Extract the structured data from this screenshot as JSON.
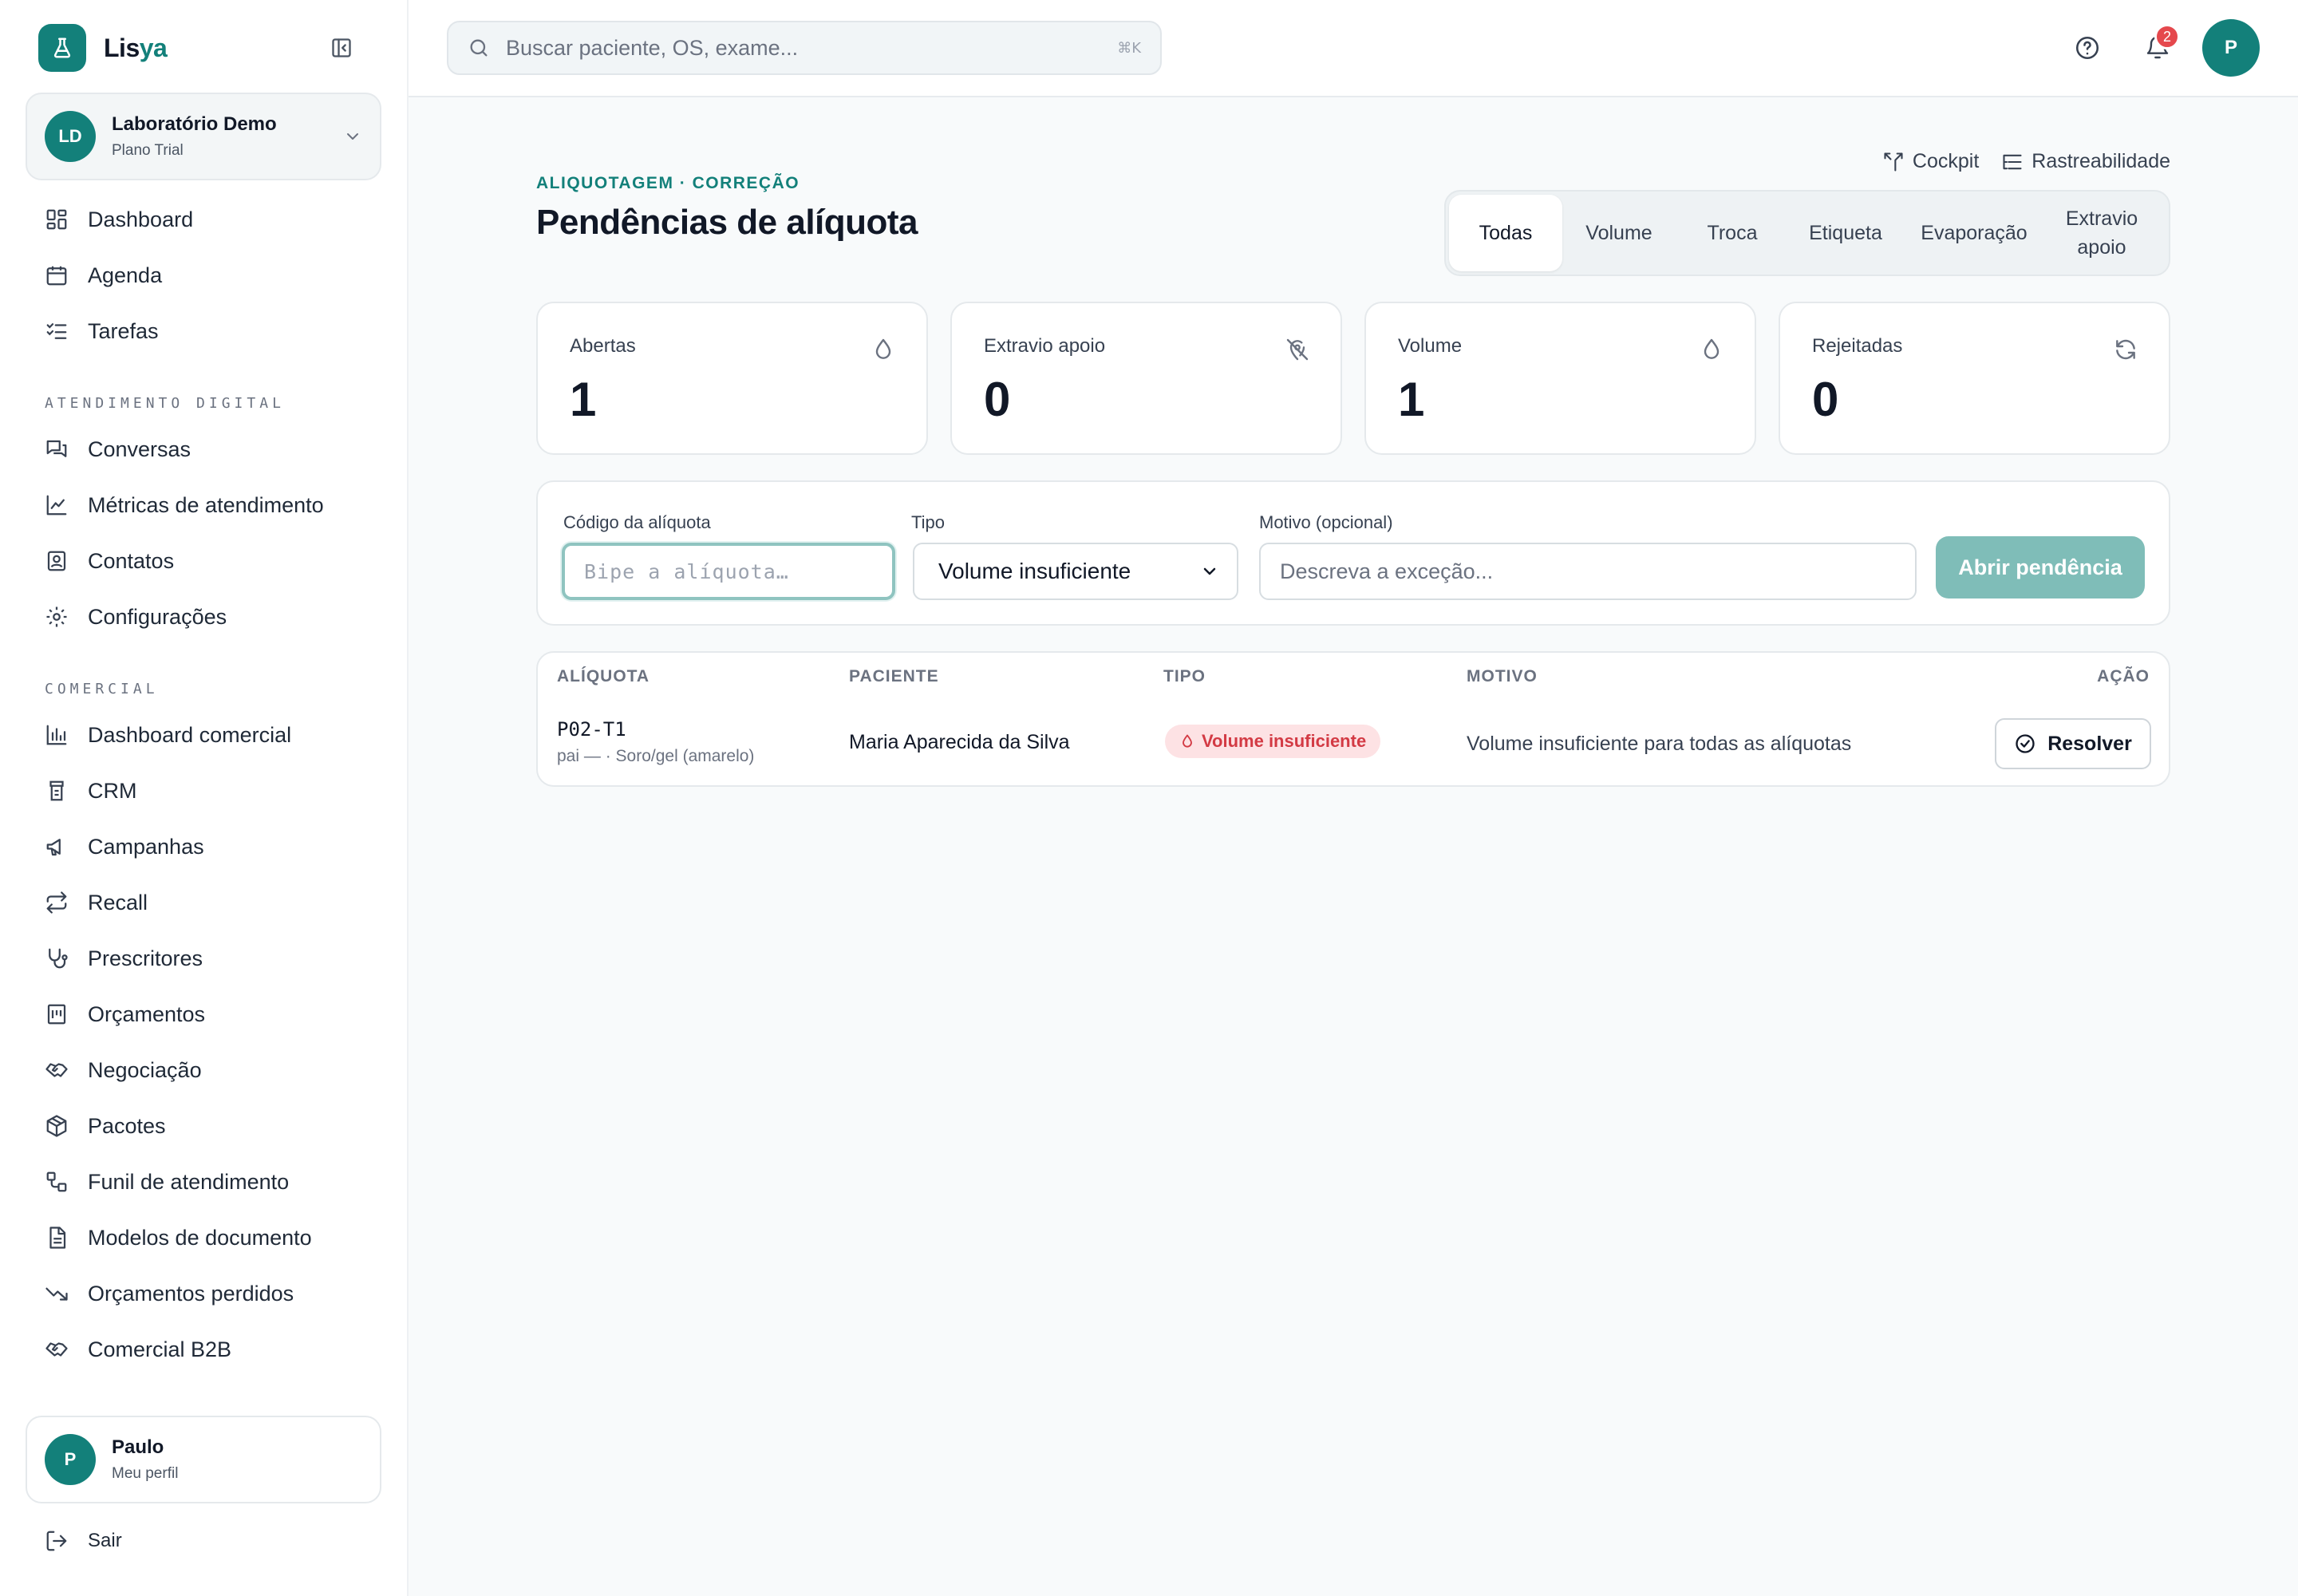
{
  "brand": {
    "name_prefix": "Lis",
    "name_suffix": "ya"
  },
  "org": {
    "initials": "LD",
    "name": "Laboratório Demo",
    "plan": "Plano Trial"
  },
  "nav": {
    "main": [
      {
        "label": "Dashboard",
        "icon": "dashboard-icon"
      },
      {
        "label": "Agenda",
        "icon": "calendar-icon"
      },
      {
        "label": "Tarefas",
        "icon": "tasks-icon"
      }
    ],
    "section_digital": "ATENDIMENTO DIGITAL",
    "digital": [
      {
        "label": "Conversas",
        "icon": "chat-icon"
      },
      {
        "label": "Métricas de atendimento",
        "icon": "line-chart-icon"
      },
      {
        "label": "Contatos",
        "icon": "contacts-icon"
      },
      {
        "label": "Configurações",
        "icon": "gear-icon"
      }
    ],
    "section_comercial": "COMERCIAL",
    "comercial": [
      {
        "label": "Dashboard comercial",
        "icon": "bar-chart-icon"
      },
      {
        "label": "CRM",
        "icon": "crm-icon"
      },
      {
        "label": "Campanhas",
        "icon": "megaphone-icon"
      },
      {
        "label": "Recall",
        "icon": "repeat-icon"
      },
      {
        "label": "Prescritores",
        "icon": "stethoscope-icon"
      },
      {
        "label": "Orçamentos",
        "icon": "receipt-icon"
      },
      {
        "label": "Negociação",
        "icon": "handshake-icon"
      },
      {
        "label": "Pacotes",
        "icon": "package-icon"
      },
      {
        "label": "Funil de atendimento",
        "icon": "workflow-icon"
      },
      {
        "label": "Modelos de documento",
        "icon": "document-icon"
      },
      {
        "label": "Orçamentos perdidos",
        "icon": "trending-down-icon"
      },
      {
        "label": "Comercial B2B",
        "icon": "handshake-icon"
      }
    ]
  },
  "profile": {
    "initial": "P",
    "name": "Paulo",
    "subtitle": "Meu perfil"
  },
  "logout_label": "Sair",
  "search": {
    "placeholder": "Buscar paciente, OS, exame...",
    "shortcut": "⌘K"
  },
  "notifications": {
    "count": "2"
  },
  "user_avatar": "P",
  "page": {
    "eyebrow": "ALIQUOTAGEM · CORREÇÃO",
    "title": "Pendências de alíquota",
    "links": {
      "cockpit": "Cockpit",
      "rastreabilidade": "Rastreabilidade"
    },
    "tabs": [
      "Todas",
      "Volume",
      "Troca",
      "Etiqueta",
      "Evaporação",
      "Extravio apoio"
    ],
    "active_tab": "Todas"
  },
  "stats": [
    {
      "label": "Abertas",
      "value": "1",
      "icon": "droplet-icon"
    },
    {
      "label": "Extravio apoio",
      "value": "0",
      "icon": "map-pin-off-icon"
    },
    {
      "label": "Volume",
      "value": "1",
      "icon": "droplet-icon"
    },
    {
      "label": "Rejeitadas",
      "value": "0",
      "icon": "refresh-icon"
    }
  ],
  "form": {
    "code_label": "Código da alíquota",
    "code_placeholder": "Bipe a alíquota…",
    "type_label": "Tipo",
    "type_value": "Volume insuficiente",
    "reason_label": "Motivo (opcional)",
    "reason_placeholder": "Descreva a exceção...",
    "submit_label": "Abrir pendência"
  },
  "table": {
    "headers": [
      "ALÍQUOTA",
      "PACIENTE",
      "TIPO",
      "MOTIVO",
      "AÇÃO"
    ],
    "rows": [
      {
        "aliquota": "P02-T1",
        "aliquota_sub": "pai — · Soro/gel (amarelo)",
        "paciente": "Maria Aparecida da Silva",
        "tipo": "Volume insuficiente",
        "motivo": "Volume insuficiente para todas as alíquotas",
        "acao": "Resolver"
      }
    ]
  },
  "colors": {
    "brand": "#13807a",
    "danger": "#d33a44",
    "button_disabled": "#7fbdb8"
  }
}
